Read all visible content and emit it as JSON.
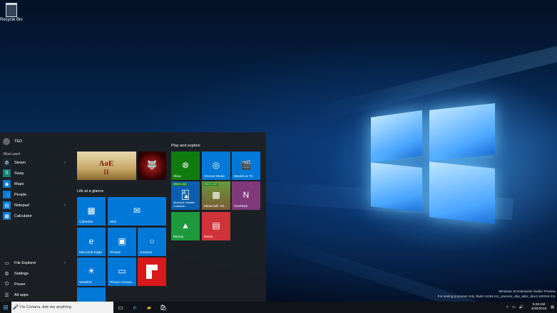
{
  "desktop": {
    "recycle_bin": "Recycle Bin",
    "watermark": {
      "line1": "Windows 10 Enterprise Insider Preview",
      "line2": "For testing purposes only. Build 14284.rs1_onecore_dep_adsc_dev2.160315-211"
    }
  },
  "start": {
    "user": "TED",
    "most_used_label": "Most used",
    "apps": [
      {
        "label": "Steam",
        "color": "#1b2838",
        "icon": "steam-icon",
        "glyph": "⚙",
        "chevron": "›"
      },
      {
        "label": "Sway",
        "color": "#108272",
        "icon": "sway-icon",
        "glyph": "S"
      },
      {
        "label": "Maps",
        "color": "#0078d7",
        "icon": "maps-icon",
        "glyph": "◉"
      },
      {
        "label": "People",
        "color": "#0078d7",
        "icon": "people-icon",
        "glyph": "👥"
      },
      {
        "label": "Notepad",
        "color": "#0078d7",
        "icon": "notepad-icon",
        "glyph": "▤",
        "chevron": "›"
      },
      {
        "label": "Calculator",
        "color": "#0078d7",
        "icon": "calculator-icon",
        "glyph": "▦"
      }
    ],
    "system": [
      {
        "label": "File Explorer",
        "icon": "folder-icon",
        "glyph": "▭",
        "chevron": "›"
      },
      {
        "label": "Settings",
        "icon": "gear-icon",
        "glyph": "⚙"
      },
      {
        "label": "Power",
        "icon": "power-icon",
        "glyph": "⏻"
      },
      {
        "label": "All apps",
        "icon": "list-icon",
        "glyph": "☰"
      }
    ],
    "groups": {
      "life": "Life at a glance",
      "play": "Play and explore"
    },
    "tiles": {
      "calendar": "Calendar",
      "mail": "Mail",
      "edge": "Microsoft Edge",
      "photos": "Photos",
      "cortana": "Cortana",
      "weather": "Weather",
      "phone": "Phone Compa...",
      "xbox": "Xbox",
      "groove": "Groove Music",
      "movies": "Movies & TV",
      "solitaire": "Microsoft Solitaire Collection",
      "minecraft": "Minecraft: Wi...",
      "onenote": "OneNote",
      "money": "Money",
      "news": "News",
      "xbox_live_badge": "XBOX LIVE"
    },
    "colors": {
      "accent": "#0078d7",
      "xbox": "#107c10",
      "onenote": "#80397b",
      "news": "#d13438",
      "money": "#1e9a3c",
      "flipboard": "#d9181d"
    }
  },
  "taskbar": {
    "search_placeholder": "I'm Cortana. Ask me anything.",
    "time": "9:28 AM",
    "date": "3/30/2016"
  }
}
